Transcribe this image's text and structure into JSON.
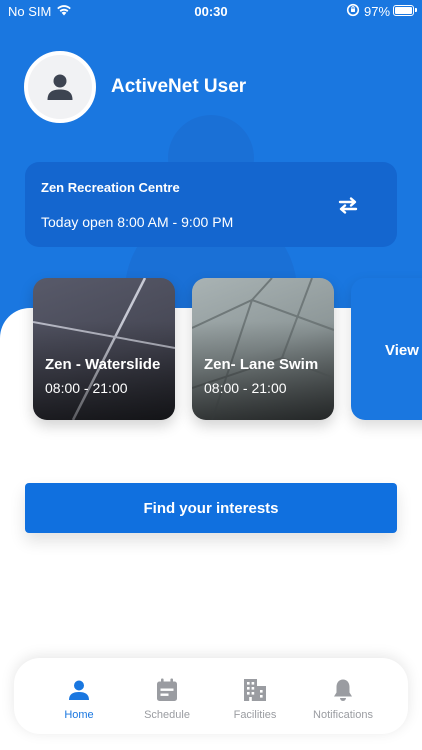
{
  "status_bar": {
    "carrier": "No SIM",
    "time": "00:30",
    "battery": "97%",
    "battery_level": 0.97
  },
  "profile": {
    "name": "ActiveNet User"
  },
  "facility": {
    "name": "Zen Recreation Centre",
    "hours": "Today open 8:00 AM - 9:00 PM"
  },
  "activities": [
    {
      "title": "Zen - Waterslide",
      "time": "08:00 - 21:00"
    },
    {
      "title": "Zen- Lane Swim",
      "time": "08:00 - 21:00"
    }
  ],
  "view_all_label": "View all",
  "find_button_label": "Find your interests",
  "tabs": [
    {
      "label": "Home",
      "icon": "person-icon",
      "active": true
    },
    {
      "label": "Schedule",
      "icon": "calendar-icon",
      "active": false
    },
    {
      "label": "Facilities",
      "icon": "building-icon",
      "active": false
    },
    {
      "label": "Notifications",
      "icon": "bell-icon",
      "active": false
    }
  ],
  "colors": {
    "brand_blue": "#1a77e0",
    "card_blue": "#1466cf",
    "inactive_gray": "#9a9ca1"
  }
}
